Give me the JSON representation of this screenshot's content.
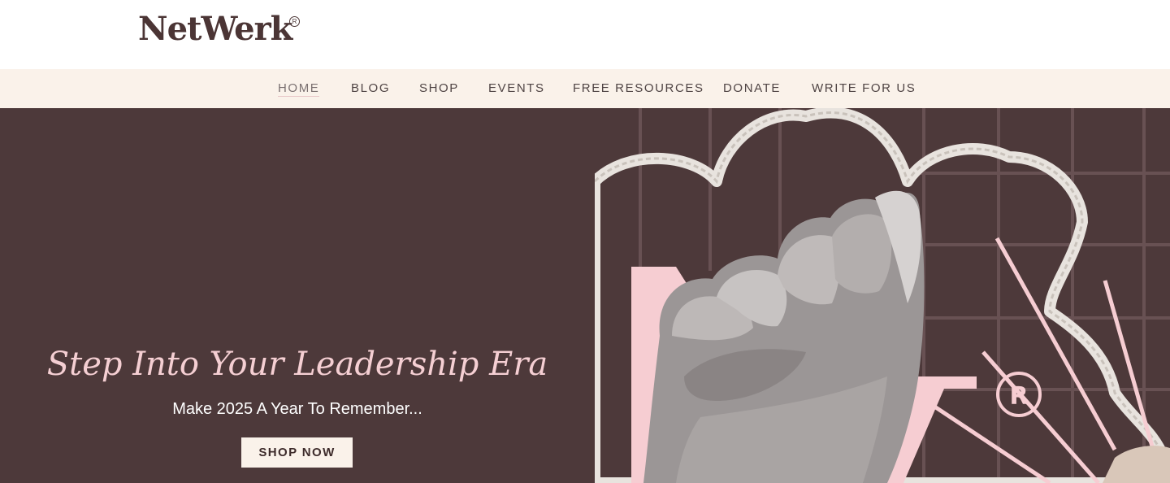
{
  "brand": {
    "logo_text": "NetWerk",
    "logo_mark": "R"
  },
  "nav": {
    "items": [
      {
        "label": "HOME",
        "active": true
      },
      {
        "label": "BLOG"
      },
      {
        "label": "SHOP"
      },
      {
        "label": "EVENTS"
      },
      {
        "label": "FREE RESOURCES"
      },
      {
        "label": "DONATE"
      },
      {
        "label": "WRITE FOR US"
      }
    ]
  },
  "hero": {
    "headline": "Step Into Your Leadership Era",
    "subheadline": "Make 2025 A Year To Remember...",
    "cta_label": "SHOP NOW",
    "art": {
      "description_icon": "raised-fist-collage-icon",
      "brand_mark": "R"
    }
  },
  "colors": {
    "hero_bg": "#4d393a",
    "nav_bg": "#faf2ea",
    "accent_pink": "#f5cfd3",
    "brand_brown": "#4b3535"
  }
}
